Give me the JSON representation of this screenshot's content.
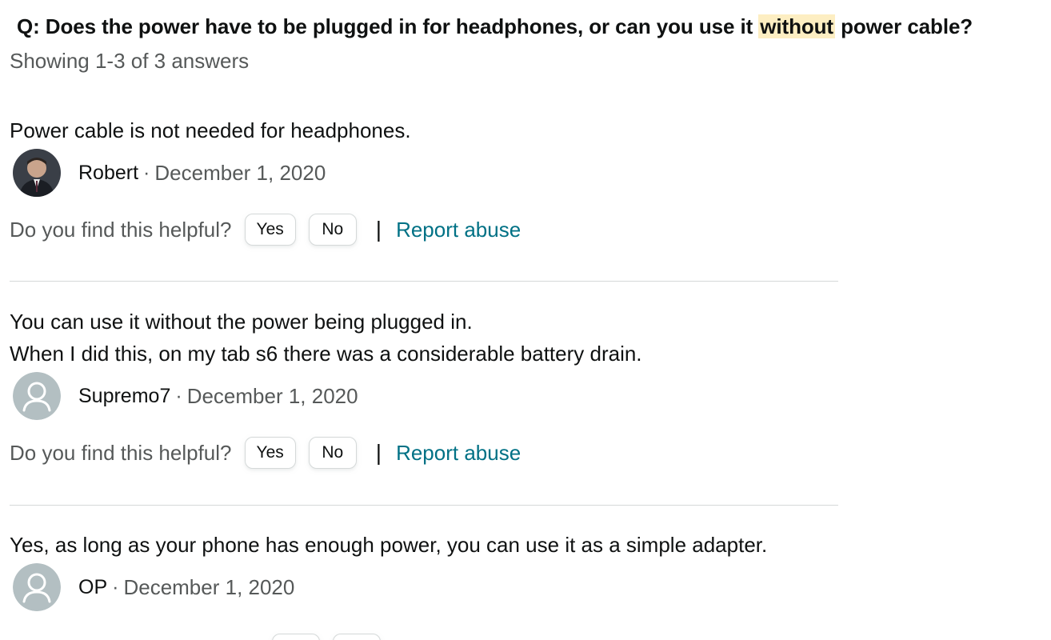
{
  "question": {
    "prefix": "Q: Does the power have to be plugged in for headphones, or can you use it ",
    "highlight": "without",
    "suffix": " power cable?"
  },
  "showing": "Showing 1-3 of 3 answers",
  "answers": [
    {
      "lines": [
        "Power cable is not needed for headphones."
      ],
      "author": "Robert",
      "separator": "·",
      "date": "December 1, 2020",
      "avatar": "photo-avatar"
    },
    {
      "lines": [
        "You can use it without the power being plugged in.",
        "When I did this, on my tab s6 there was a considerable battery drain."
      ],
      "author": "Supremo7",
      "separator": "·",
      "date": "December 1, 2020",
      "avatar": "default-avatar"
    },
    {
      "lines": [
        "Yes, as long as your phone has enough power, you can use it as a simple adapter."
      ],
      "author": "OP",
      "separator": "·",
      "date": "December 1, 2020",
      "avatar": "default-avatar"
    }
  ],
  "helpful": {
    "question": "Do you find this helpful?",
    "yes_label": "Yes",
    "no_label": "No",
    "pipe": "|",
    "report_label": "Report abuse"
  },
  "colors": {
    "highlight": "#fdeec2",
    "muted_text": "#565959",
    "link": "#007185",
    "divider": "#d5d9d9"
  }
}
